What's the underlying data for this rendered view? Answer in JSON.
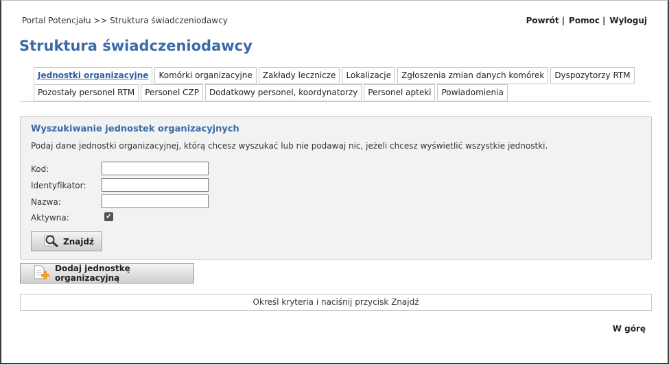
{
  "breadcrumb": "Portal Potencjału >> Struktura świadczeniodawcy",
  "topnav": {
    "back": "Powrót",
    "help": "Pomoc",
    "logout": "Wyloguj",
    "separator": "|"
  },
  "page_title": "Struktura świadczeniodawcy",
  "tabs": {
    "row1": [
      {
        "label": "Jednostki organizacyjne",
        "active": true
      },
      {
        "label": "Komórki organizacyjne"
      },
      {
        "label": "Zakłady lecznicze"
      },
      {
        "label": "Lokalizacje"
      },
      {
        "label": "Zgłoszenia zmian danych komórek"
      },
      {
        "label": "Dyspozytorzy RTM"
      }
    ],
    "row2": [
      {
        "label": "Pozostały personel RTM"
      },
      {
        "label": "Personel CZP"
      },
      {
        "label": "Dodatkowy personel, koordynatorzy"
      },
      {
        "label": "Personel apteki"
      },
      {
        "label": "Powiadomienia"
      }
    ]
  },
  "search": {
    "title": "Wyszukiwanie jednostek organizacyjnych",
    "description": "Podaj dane jednostki organizacyjnej, którą chcesz wyszukać lub nie podawaj nic, jeżeli chcesz wyświetlić wszystkie jednostki.",
    "fields": {
      "kod": {
        "label": "Kod:",
        "value": ""
      },
      "identyfikator": {
        "label": "Identyfikator:",
        "value": ""
      },
      "nazwa": {
        "label": "Nazwa:",
        "value": ""
      },
      "aktywna": {
        "label": "Aktywna:",
        "checked": true
      }
    },
    "button_label": "Znajdź"
  },
  "add_button_label": "Dodaj jednostkę organizacyjną",
  "results_message": "Określ kryteria i naciśnij przycisk Znajdź",
  "back_to_top": "W górę",
  "colors": {
    "title": "#3a6aa8",
    "active_tab": "#2f5f9f",
    "panel_bg": "#f2f2f2"
  },
  "icons": {
    "search_button": "magnifier-icon",
    "add_button": "document-add-icon",
    "checkbox": "checkmark-icon"
  }
}
